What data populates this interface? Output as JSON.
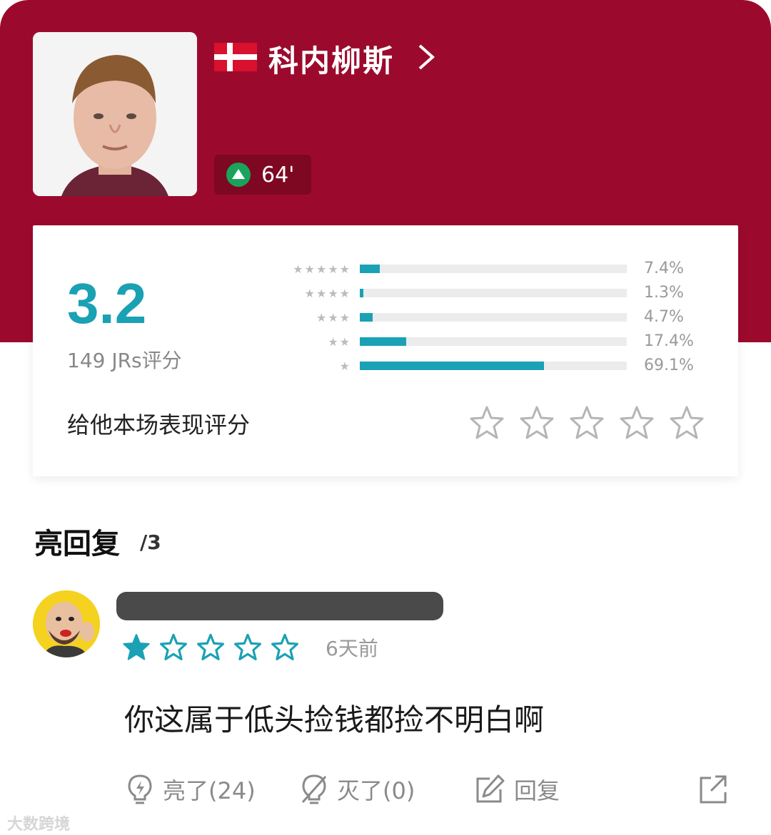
{
  "player": {
    "name": "科内柳斯",
    "sub_minute": "64'"
  },
  "rating": {
    "score": "3.2",
    "count_text": "149 JRs评分",
    "rate_prompt": "给他本场表现评分",
    "distribution": [
      {
        "stars": 5,
        "percent": 7.4,
        "label": "7.4%"
      },
      {
        "stars": 4,
        "percent": 1.3,
        "label": "1.3%"
      },
      {
        "stars": 3,
        "percent": 4.7,
        "label": "4.7%"
      },
      {
        "stars": 2,
        "percent": 17.4,
        "label": "17.4%"
      },
      {
        "stars": 1,
        "percent": 69.1,
        "label": "69.1%"
      }
    ]
  },
  "highlights": {
    "title": "亮回复",
    "count": "/3"
  },
  "comment": {
    "user_rating": 1,
    "time": "6天前",
    "text": "你这属于低头捡钱都捡不明白啊",
    "actions": {
      "like": "亮了(24)",
      "dislike": "灭了(0)",
      "reply": "回复"
    }
  },
  "watermark": "大数跨境",
  "colors": {
    "header": "#9b0a2d",
    "accent": "#1aa1b4",
    "sub_green": "#19a35b"
  }
}
